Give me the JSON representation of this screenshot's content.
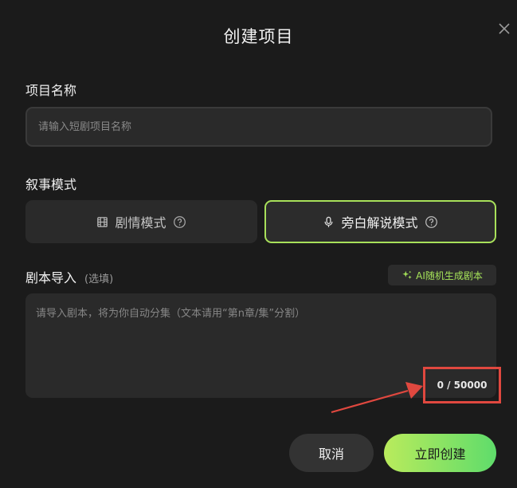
{
  "dialog": {
    "title": "创建项目",
    "close_icon": "close-icon"
  },
  "project_name": {
    "label": "项目名称",
    "placeholder": "请输入短剧项目名称",
    "value": ""
  },
  "narrative_mode": {
    "label": "叙事模式",
    "options": [
      {
        "label": "剧情模式",
        "icon": "film-icon",
        "help_icon": "help-circle-icon",
        "selected": false
      },
      {
        "label": "旁白解说模式",
        "icon": "microphone-icon",
        "help_icon": "help-circle-icon",
        "selected": true
      }
    ]
  },
  "script_import": {
    "label": "剧本导入",
    "optional_label": "(选填)",
    "ai_button_label": "AI随机生成剧本",
    "ai_icon": "sparkle-icon",
    "placeholder": "请导入剧本，将为你自动分集（文本请用“第n章/集”分割）",
    "value": "",
    "counter": "0 / 50000"
  },
  "actions": {
    "cancel_label": "取消",
    "create_label": "立即创建"
  },
  "colors": {
    "accent": "#a8e05a",
    "annotation": "#e0483f",
    "background": "#1b1b1b",
    "field": "#2a2a2a"
  }
}
